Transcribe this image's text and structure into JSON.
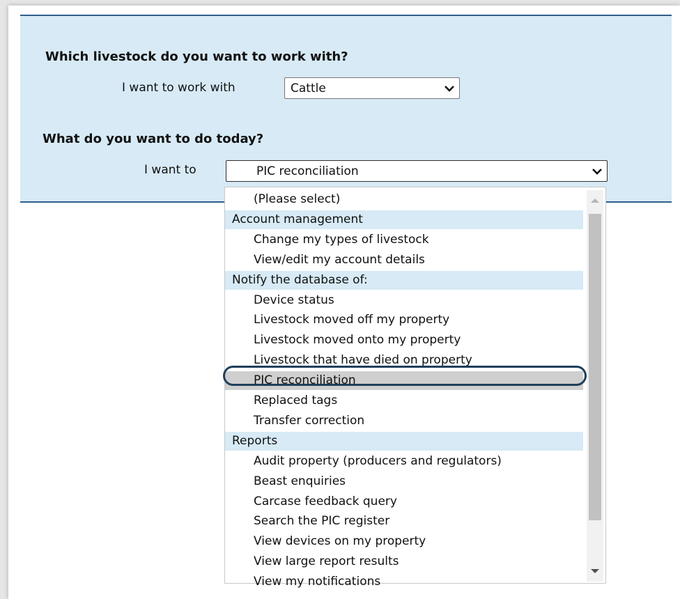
{
  "livestock_section": {
    "question": "Which livestock do you want to work with?",
    "label": "I want to work with",
    "selected": "Cattle"
  },
  "task_section": {
    "question": "What do you want to do today?",
    "label": "I want to",
    "selected": "PIC reconciliation"
  },
  "dropdown": {
    "options": [
      {
        "label": "(Please select)",
        "kind": "group"
      },
      {
        "label": "Account management",
        "kind": "group"
      },
      {
        "label": "Change my types of livestock",
        "kind": "item"
      },
      {
        "label": "View/edit my account details",
        "kind": "item"
      },
      {
        "label": "Notify the database of:",
        "kind": "group"
      },
      {
        "label": "Device status",
        "kind": "item"
      },
      {
        "label": "Livestock moved off my property",
        "kind": "item"
      },
      {
        "label": "Livestock moved onto my property",
        "kind": "item"
      },
      {
        "label": "Livestock that have died on property",
        "kind": "item"
      },
      {
        "label": "PIC reconciliation",
        "kind": "item",
        "selected": true
      },
      {
        "label": "Replaced tags",
        "kind": "item"
      },
      {
        "label": "Transfer correction",
        "kind": "item"
      },
      {
        "label": "Reports",
        "kind": "group"
      },
      {
        "label": "Audit property (producers and regulators)",
        "kind": "item"
      },
      {
        "label": "Beast enquiries",
        "kind": "item"
      },
      {
        "label": "Carcase feedback query",
        "kind": "item"
      },
      {
        "label": "Search the PIC register",
        "kind": "item"
      },
      {
        "label": "View devices on my property",
        "kind": "item"
      },
      {
        "label": "View large report results",
        "kind": "item"
      },
      {
        "label": "View my notifications",
        "kind": "item"
      }
    ]
  },
  "colors": {
    "panel_bg": "#d7eaf5",
    "panel_border": "#2f5e8c",
    "group_bg": "#d7eaf5",
    "selected_bg": "#cfcfcf",
    "highlight_ring": "#1f3f5a"
  }
}
